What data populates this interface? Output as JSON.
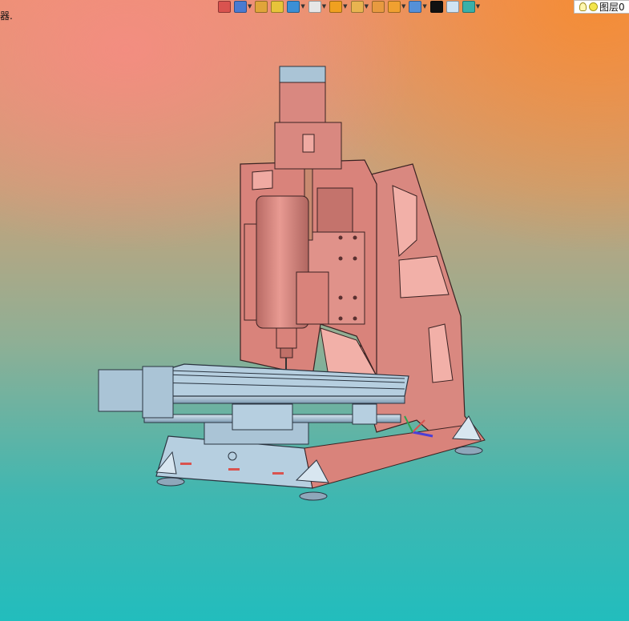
{
  "status": {
    "corner_text": "器."
  },
  "toolbar": {
    "items": [
      {
        "name": "exit-icon",
        "color": "#d9534f",
        "dropdown": false
      },
      {
        "name": "view-orientation-icon",
        "color": "#4a7bd1",
        "dropdown": true
      },
      {
        "name": "pencil-icon",
        "color": "#e0a53a",
        "dropdown": false
      },
      {
        "name": "sketch-cube-icon",
        "color": "#e7c43a",
        "dropdown": false
      },
      {
        "name": "section-view-icon",
        "color": "#3b8fd6",
        "dropdown": true
      },
      {
        "name": "cube-icon",
        "color": "#e6e6e6",
        "dropdown": true
      },
      {
        "name": "display-style-icon",
        "color": "#f0a020",
        "dropdown": true
      },
      {
        "name": "hide-show-icon",
        "color": "#e8b450",
        "dropdown": true
      },
      {
        "name": "appearance-icon",
        "color": "#e89a40",
        "dropdown": false
      },
      {
        "name": "scene-icon",
        "color": "#f0a030",
        "dropdown": true
      },
      {
        "name": "view-settings-icon",
        "color": "#5590d8",
        "dropdown": true
      },
      {
        "name": "line-color-icon",
        "color": "#111111",
        "dropdown": false
      },
      {
        "name": "page-icon",
        "color": "#cfe3f3",
        "dropdown": false
      },
      {
        "name": "layers-icon",
        "color": "#3ab0a8",
        "dropdown": true
      }
    ],
    "layer_label": "图层0"
  },
  "viewport": {
    "background_top": "#e9946f",
    "background_bottom": "#22bdbd",
    "frame_color": "#d98880",
    "metal_color": "#aac4d6"
  }
}
